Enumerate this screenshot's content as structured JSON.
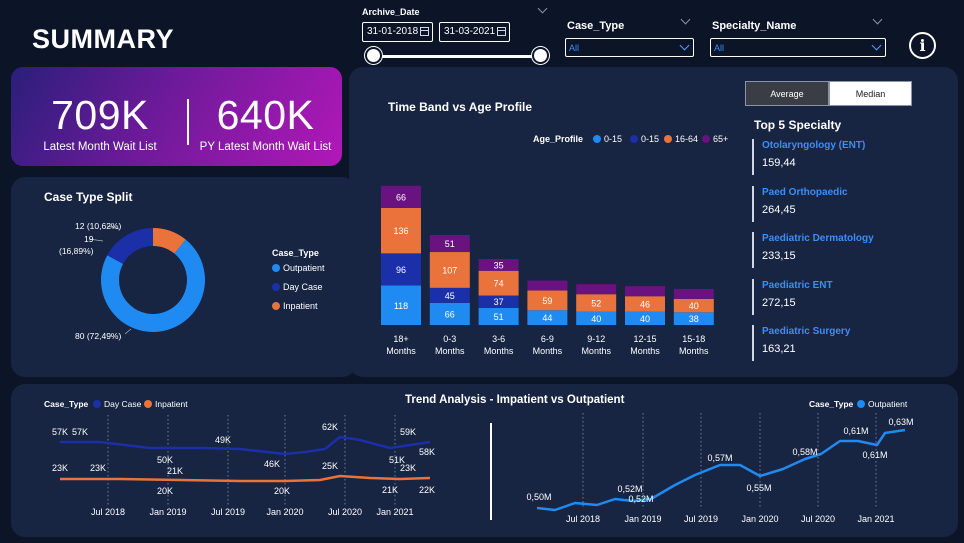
{
  "header": {
    "title": "SUMMARY"
  },
  "filters": {
    "archive_date": {
      "label": "Archive_Date",
      "start": "31-01-2018",
      "end": "31-03-2021"
    },
    "case_type": {
      "label": "Case_Type",
      "value": "All"
    },
    "specialty_name": {
      "label": "Specialty_Name",
      "value": "All"
    }
  },
  "kpis": [
    {
      "value": "709K",
      "label": "Latest Month Wait List"
    },
    {
      "value": "640K",
      "label": "PY Latest Month Wait List"
    }
  ],
  "toggle": {
    "average": "Average",
    "median": "Median",
    "active": "average"
  },
  "case_type_split": {
    "title": "Case Type Split",
    "legend_title": "Case_Type",
    "legend": [
      "Outpatient",
      "Day Case",
      "Inpatient"
    ],
    "labels": {
      "inpatient": "12 (10,62%)",
      "daycase_count": "19",
      "daycase_pct": "(16,89%)",
      "outpatient": "80 (72,49%)"
    }
  },
  "colors": {
    "outpatient": "#1f8bf2",
    "daycase": "#1b2fa8",
    "inpatient": "#e9733b",
    "age65": "#6a1280",
    "background": "#0c1428",
    "card": "#172442",
    "accent": "#3d8ef7"
  },
  "time_band": {
    "title": "Time Band vs Age Profile",
    "legend_title": "Age_Profile",
    "legend": [
      "0-15",
      "0-15",
      "16-64",
      "65+"
    ]
  },
  "top5": {
    "title": "Top 5 Specialty",
    "items": [
      {
        "name": "Otolaryngology (ENT)",
        "value": "159,44"
      },
      {
        "name": "Paed Orthopaedic",
        "value": "264,45"
      },
      {
        "name": "Paediatric Dermatology",
        "value": "233,15"
      },
      {
        "name": "Paediatric ENT",
        "value": "272,15"
      },
      {
        "name": "Paediatric Surgery",
        "value": "163,21"
      }
    ]
  },
  "trend": {
    "title": "Trend Analysis - Impatient vs Outpatient",
    "left_legend_title": "Case_Type",
    "left_legend": [
      "Day Case",
      "Inpatient"
    ],
    "right_legend_title": "Case_Type",
    "right_legend": [
      "Outpatient"
    ],
    "left_ticks": [
      "Jul 2018",
      "Jan 2019",
      "Jul 2019",
      "Jan 2020",
      "Jul 2020",
      "Jan 2021"
    ],
    "right_ticks": [
      "Jul 2018",
      "Jan 2019",
      "Jul 2019",
      "Jan 2020",
      "Jul 2020",
      "Jan 2021"
    ],
    "left_labels": {
      "dc": [
        "57K",
        "57K",
        "50K",
        "49K",
        "46K",
        "62K",
        "59K",
        "51K",
        "58K"
      ],
      "ip": [
        "23K",
        "23K",
        "21K",
        "20K",
        "20K",
        "25K",
        "21K",
        "23K",
        "22K"
      ]
    },
    "right_labels": [
      "0,50M",
      "0,52M",
      "0,52M",
      "0,57M",
      "0,55M",
      "0,58M",
      "0,61M",
      "0,61M",
      "0,63M"
    ]
  },
  "chart_data": [
    {
      "type": "bar",
      "title": "Time Band vs Age Profile",
      "categories": [
        "18+ Months",
        "0-3 Months",
        "3-6 Months",
        "6-9 Months",
        "9-12 Months",
        "12-15 Months",
        "15-18 Months"
      ],
      "series": [
        {
          "name": "0-15",
          "color": "#1f8bf2",
          "values": [
            118,
            66,
            51,
            44,
            40,
            40,
            38
          ]
        },
        {
          "name": "0-15",
          "color": "#1b2fa8",
          "values": [
            96,
            45,
            37,
            null,
            null,
            null,
            null
          ]
        },
        {
          "name": "16-64",
          "color": "#e9733b",
          "values": [
            136,
            107,
            74,
            59,
            52,
            46,
            40
          ]
        },
        {
          "name": "65+",
          "color": "#6a1280",
          "values": [
            66,
            51,
            35,
            null,
            null,
            null,
            null
          ]
        }
      ]
    },
    {
      "type": "pie",
      "title": "Case Type Split",
      "categories": [
        "Outpatient",
        "Day Case",
        "Inpatient"
      ],
      "values": [
        80,
        19,
        12
      ]
    },
    {
      "type": "line",
      "title": "Trend Analysis - Impatient vs Outpatient",
      "series": [
        {
          "name": "Day Case",
          "values": [
            57,
            57,
            50,
            49,
            46,
            62,
            59,
            51,
            58
          ]
        },
        {
          "name": "Inpatient",
          "values": [
            23,
            23,
            21,
            20,
            20,
            25,
            21,
            23,
            22
          ]
        },
        {
          "name": "Outpatient",
          "values": [
            0.5,
            0.52,
            0.52,
            0.57,
            0.55,
            0.58,
            0.61,
            0.61,
            0.63
          ]
        }
      ]
    }
  ]
}
